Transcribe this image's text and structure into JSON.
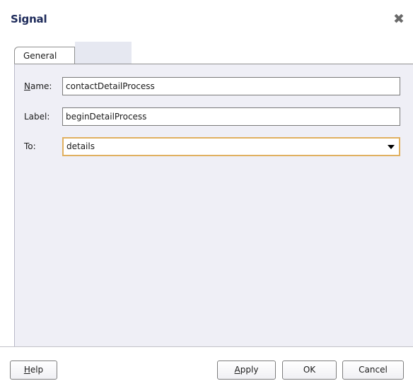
{
  "dialog": {
    "title": "Signal",
    "close_glyph": "✖",
    "close_icon": "close-icon"
  },
  "tabs": [
    {
      "label": "General",
      "selected": true
    }
  ],
  "form": {
    "name": {
      "label_mnemonic": "N",
      "label_rest": "ame:",
      "value": "contactDetailProcess"
    },
    "label": {
      "label": "Label:",
      "value": "beginDetailProcess"
    },
    "to": {
      "label": "To:",
      "value": "details",
      "arrow_icon": "dropdown-arrow-icon"
    }
  },
  "buttons": {
    "help": {
      "mnemonic": "H",
      "rest": "elp"
    },
    "apply": {
      "mnemonic": "A",
      "rest": "pply"
    },
    "ok": {
      "label": "OK"
    },
    "cancel": {
      "label": "Cancel"
    }
  },
  "colors": {
    "title": "#1d2a5a",
    "panel_bg": "#efeff6",
    "focus_border": "#e0b060",
    "tab_strip_bg": "#e6e8f1"
  }
}
